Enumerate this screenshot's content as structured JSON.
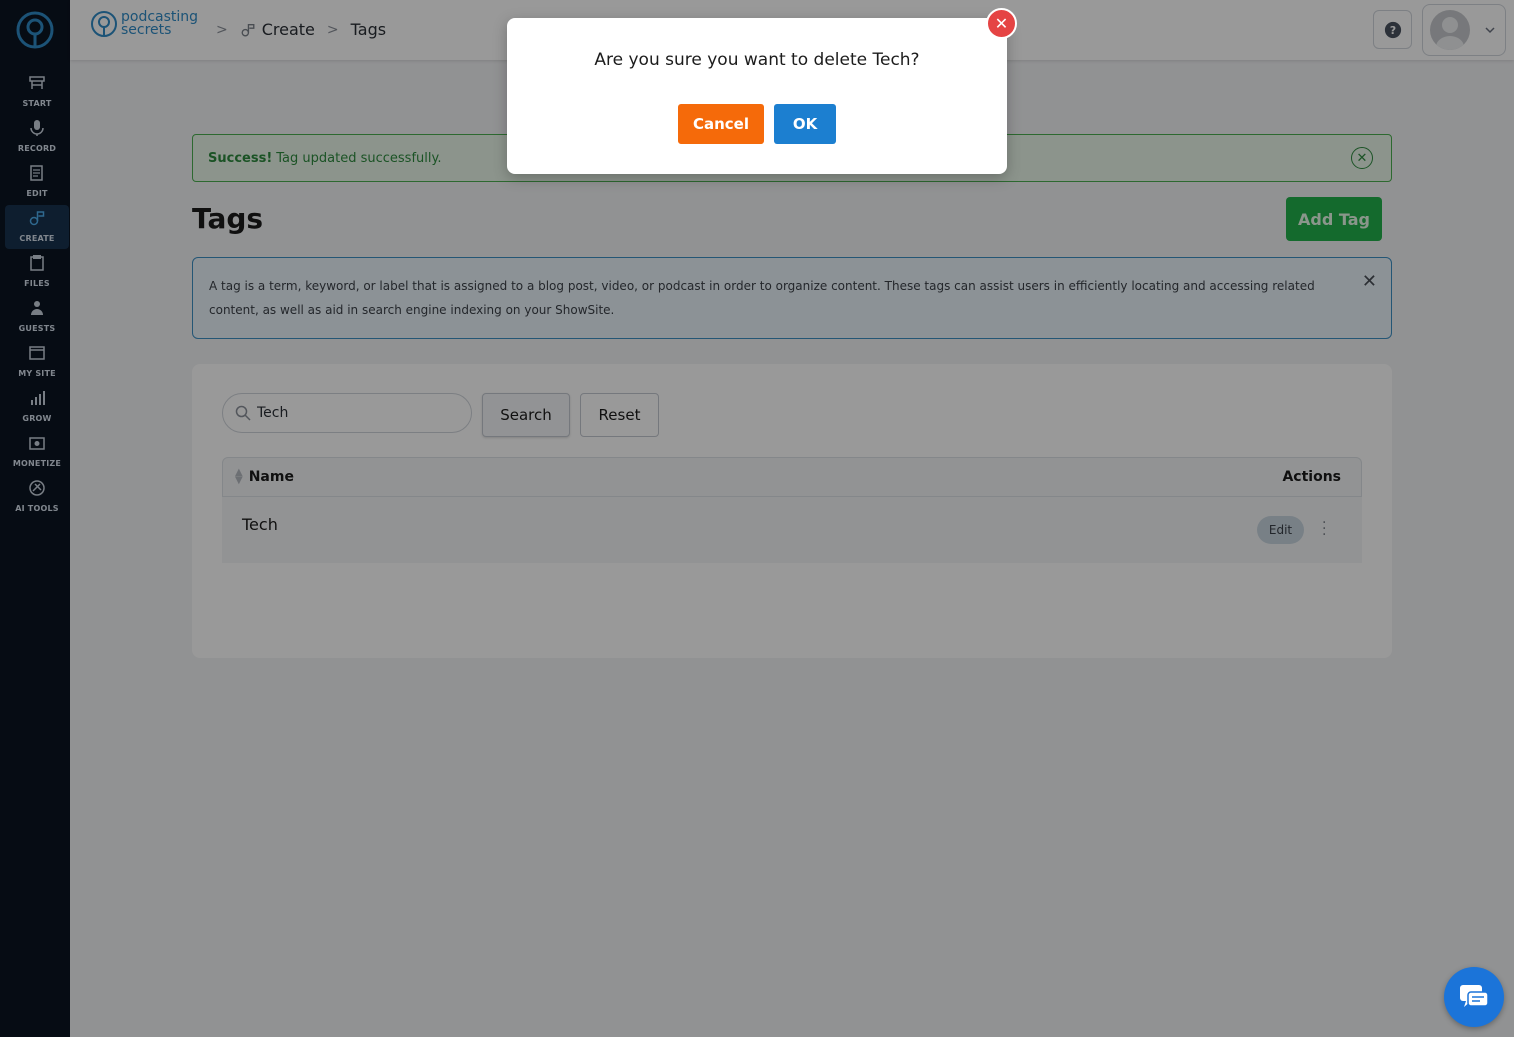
{
  "brand": {
    "line1": "podcasting",
    "line2": "secrets"
  },
  "sidebar": {
    "items": [
      {
        "label": "START",
        "icon": "start-icon"
      },
      {
        "label": "RECORD",
        "icon": "microphone-icon"
      },
      {
        "label": "EDIT",
        "icon": "edit-icon"
      },
      {
        "label": "CREATE",
        "icon": "create-icon",
        "active": true
      },
      {
        "label": "FILES",
        "icon": "files-icon"
      },
      {
        "label": "GUESTS",
        "icon": "guests-icon"
      },
      {
        "label": "MY SITE",
        "icon": "site-icon"
      },
      {
        "label": "GROW",
        "icon": "grow-icon"
      },
      {
        "label": "MONETIZE",
        "icon": "monetize-icon"
      },
      {
        "label": "AI TOOLS",
        "icon": "ai-tools-icon"
      }
    ]
  },
  "breadcrumb": {
    "create": "Create",
    "tags": "Tags",
    "separator": ">"
  },
  "alert": {
    "strong": "Success!",
    "message": "Tag updated successfully."
  },
  "page": {
    "title": "Tags",
    "add_button": "Add Tag",
    "info": "A tag is a term, keyword, or label that is assigned to a blog post, video, or podcast in order to organize content. These tags can assist users in efficiently locating and accessing related content, as well as aid in search engine indexing on your ShowSite."
  },
  "search": {
    "value": "Tech",
    "search_button": "Search",
    "reset_button": "Reset"
  },
  "table": {
    "columns": {
      "name": "Name",
      "actions": "Actions"
    },
    "rows": [
      {
        "name": "Tech",
        "edit_label": "Edit"
      }
    ]
  },
  "dialog": {
    "message": "Are you sure you want to delete Tech?",
    "cancel": "Cancel",
    "ok": "OK"
  },
  "colors": {
    "sidebar_bg": "#0b1422",
    "success": "#2e8b3f",
    "add_button": "#22b14c",
    "cancel_button": "#f56a0a",
    "ok_button": "#1c7fd0",
    "close_button": "#e54444",
    "chat_button": "#1b74d9"
  }
}
